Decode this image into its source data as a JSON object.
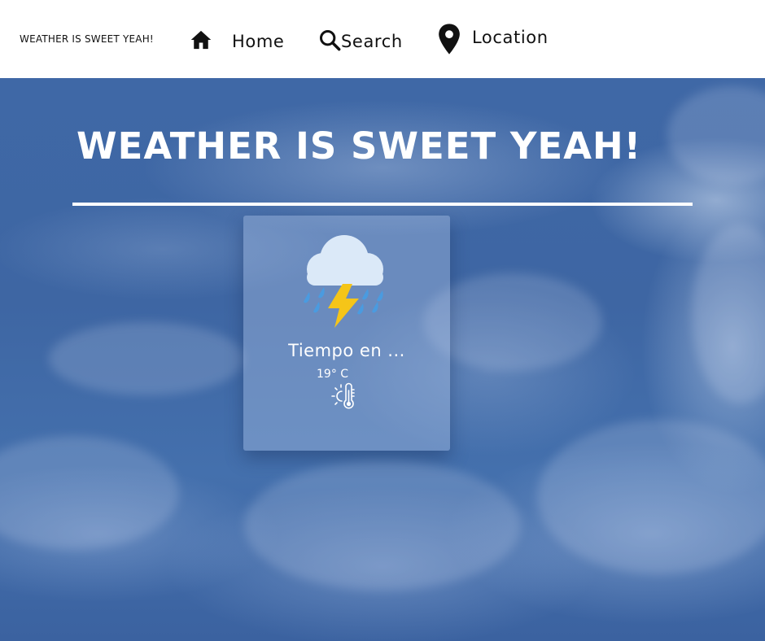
{
  "header": {
    "brand": "WEATHER IS SWEET YEAH!",
    "nav": {
      "home": {
        "label": "Home",
        "icon": "home-icon"
      },
      "search": {
        "label": "Search",
        "icon": "search-icon"
      },
      "location": {
        "label": "Location",
        "icon": "map-pin-icon"
      }
    }
  },
  "hero": {
    "title": "WEATHER IS SWEET YEAH!"
  },
  "weather_card": {
    "condition_icon": "thunderstorm-rain-icon",
    "title": "Tiempo en ...",
    "temperature": "19° C",
    "temperature_icon": "sun-thermometer-icon"
  },
  "colors": {
    "header_bg": "#ffffff",
    "sky_blue": "#3f68a6",
    "title_text": "#ffffff",
    "lightning": "#f5c518",
    "raindrop": "#4a9be0",
    "cloud": "#dbe9f8"
  }
}
